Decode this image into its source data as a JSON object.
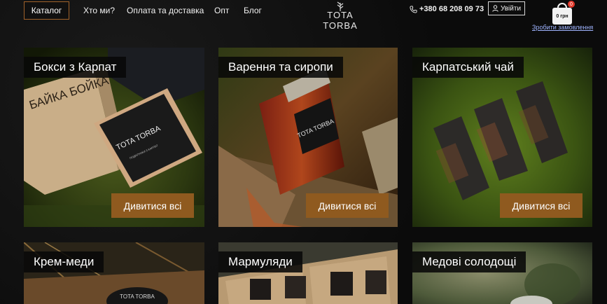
{
  "header": {
    "nav": [
      {
        "label": "Каталог"
      },
      {
        "label": "Хто ми?"
      },
      {
        "label": "Оплата та доставка"
      },
      {
        "label": "Опт"
      },
      {
        "label": "Блог"
      }
    ],
    "logo": {
      "line1": "TOTA",
      "line2": "TORBA"
    },
    "phone": "+380 68 208 09 73",
    "login_label": "Увійти",
    "cart": {
      "count": "0",
      "amount": "0 грн"
    },
    "order_link": "Зробити замовлення"
  },
  "cards": [
    {
      "title": "Бокси з Карпат",
      "button": "Дивитися всі"
    },
    {
      "title": "Варення та сиропи",
      "button": "Дивитися всі"
    },
    {
      "title": "Карпатський чай",
      "button": "Дивитися всі"
    },
    {
      "title": "Крем-меди"
    },
    {
      "title": "Мармуляди"
    },
    {
      "title": "Медові солодощі"
    }
  ],
  "photo_text": {
    "box_brand": "TOTA TORBA",
    "box_tagline": "ПОДАРУНКИ З КАРПАТ",
    "kraft_box": "БАЙКА БОЙКА",
    "jar_brand": "TOTA TORBA"
  },
  "colors": {
    "accent": "#8f5a1f",
    "catalog_border": "#a0622a",
    "badge": "#e23a2c",
    "link": "#9fb4ff"
  }
}
